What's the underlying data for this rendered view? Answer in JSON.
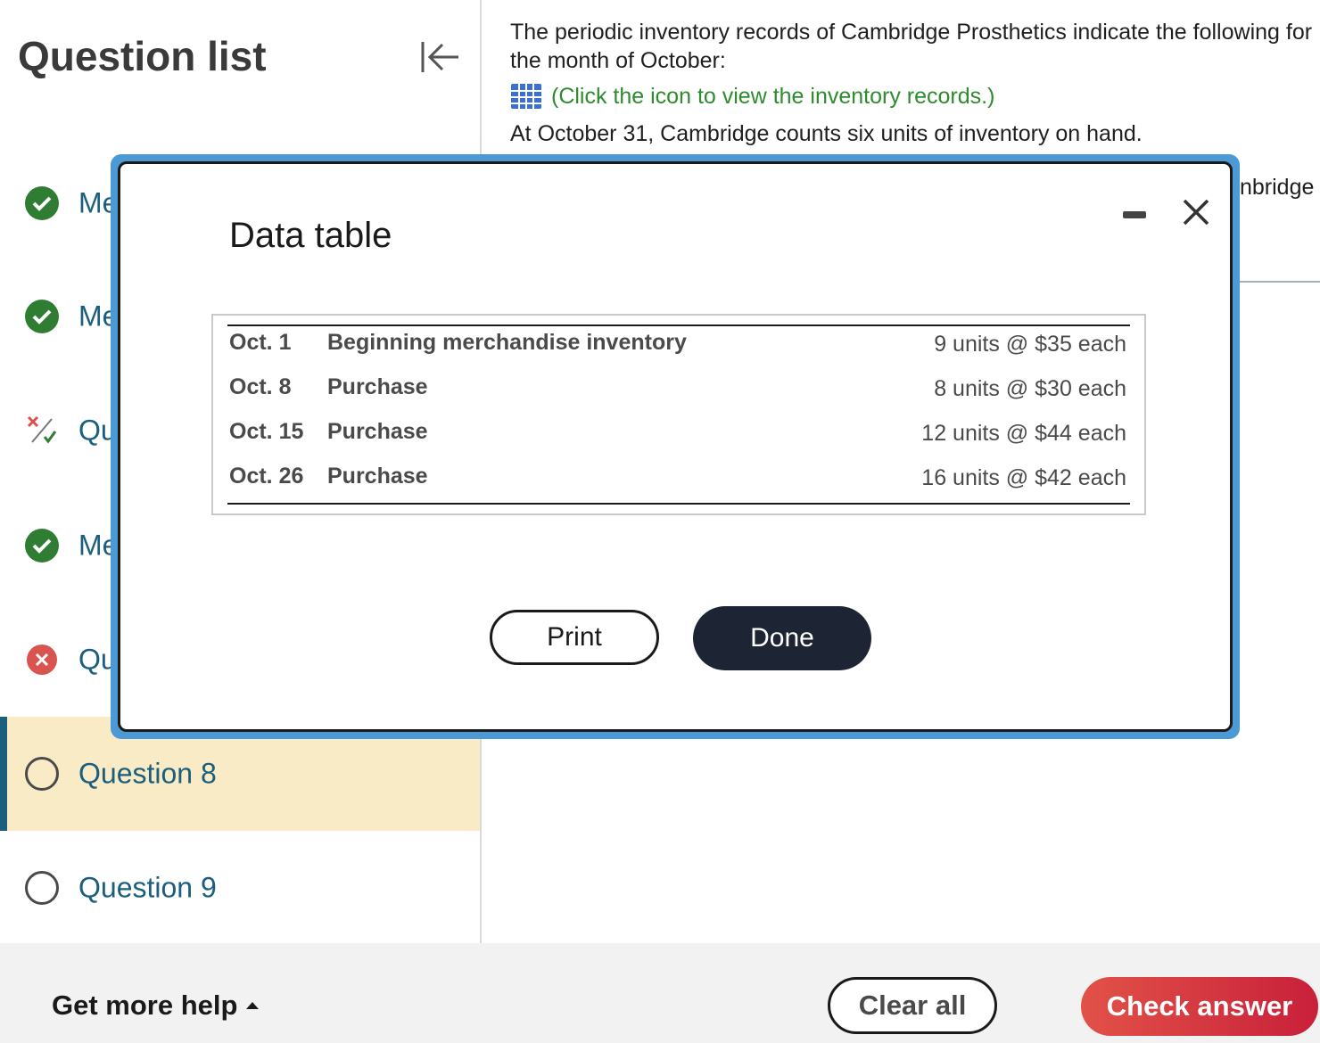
{
  "sidebar": {
    "title": "Question list",
    "collapse_icon": "collapse-left-icon",
    "items": [
      {
        "label": "Me",
        "status": "correct"
      },
      {
        "label": "Me",
        "status": "correct"
      },
      {
        "label": "Qu",
        "status": "partial"
      },
      {
        "label": "Me",
        "status": "correct"
      },
      {
        "label": "Qu",
        "status": "incorrect"
      },
      {
        "label": "Question 8",
        "status": "unanswered",
        "active": true
      },
      {
        "label": "Question 9",
        "status": "unanswered"
      }
    ]
  },
  "question": {
    "text1": "The periodic inventory records of Cambridge Prosthetics indicate the following for the month of October:",
    "records_link": "(Click the icon to view the inventory records.)",
    "text2": "At October 31, Cambridge counts six units of inventory on hand.",
    "partial_text": "nbridge"
  },
  "modal": {
    "title": "Data table",
    "rows": [
      {
        "date": "Oct. 1",
        "description": "Beginning merchandise inventory",
        "amount": "9 units @ $35 each"
      },
      {
        "date": "Oct. 8",
        "description": "Purchase",
        "amount": "8 units @ $30 each"
      },
      {
        "date": "Oct. 15",
        "description": "Purchase",
        "amount": "12 units @ $44 each"
      },
      {
        "date": "Oct. 26",
        "description": "Purchase",
        "amount": "16 units @ $42 each"
      }
    ],
    "print_label": "Print",
    "done_label": "Done"
  },
  "footer": {
    "help_label": "Get more help",
    "clear_label": "Clear all",
    "check_label": "Check answer"
  },
  "colors": {
    "accent": "#1b5e7e",
    "correct": "#2e7d32",
    "incorrect": "#d9534f",
    "link": "#2e8b2e",
    "active_bg": "#f8ebc5",
    "modal_border": "#4b9ad6",
    "check_button": "#d93a40"
  }
}
